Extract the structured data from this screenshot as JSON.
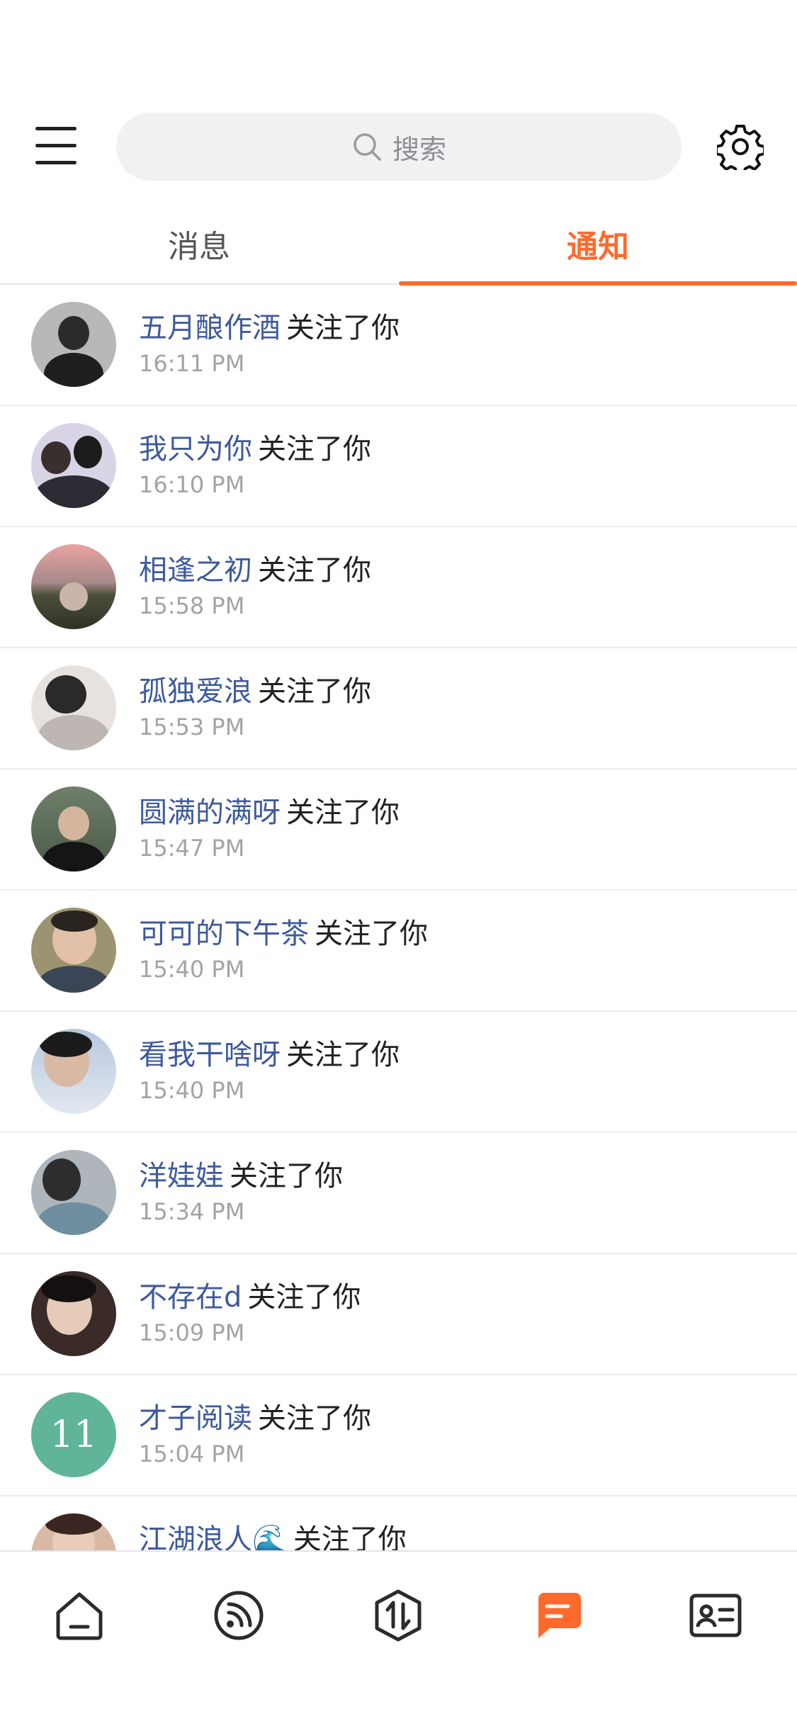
{
  "header": {
    "search_placeholder": "搜索"
  },
  "tabs": [
    {
      "label": "消息",
      "active": false
    },
    {
      "label": "通知",
      "active": true
    }
  ],
  "accent_color": "#ff6a2c",
  "notifications": [
    {
      "name": "五月酿作酒",
      "action": "关注了你",
      "time": "16:11 PM"
    },
    {
      "name": "我只为你",
      "action": "关注了你",
      "time": "16:10 PM"
    },
    {
      "name": "相逢之初",
      "action": "关注了你",
      "time": "15:58 PM"
    },
    {
      "name": "孤独爱浪",
      "action": "关注了你",
      "time": "15:53 PM"
    },
    {
      "name": "圆满的满呀",
      "action": "关注了你",
      "time": "15:47 PM"
    },
    {
      "name": "可可的下午茶",
      "action": "关注了你",
      "time": "15:40 PM"
    },
    {
      "name": "看我干啥呀",
      "action": "关注了你",
      "time": "15:40 PM"
    },
    {
      "name": "洋娃娃",
      "action": "关注了你",
      "time": "15:34 PM"
    },
    {
      "name": "不存在d",
      "action": "关注了你",
      "time": "15:09 PM"
    },
    {
      "name": "才子阅读",
      "action": "关注了你",
      "time": "15:04 PM",
      "avatar_text": "11"
    },
    {
      "name": "江湖浪人🌊",
      "action": "关注了你",
      "time": ""
    }
  ],
  "bottom_nav": [
    {
      "icon": "home-icon",
      "active": false
    },
    {
      "icon": "feed-icon",
      "active": false
    },
    {
      "icon": "exchange-icon",
      "active": false
    },
    {
      "icon": "chat-icon",
      "active": true
    },
    {
      "icon": "profile-card-icon",
      "active": false
    }
  ]
}
